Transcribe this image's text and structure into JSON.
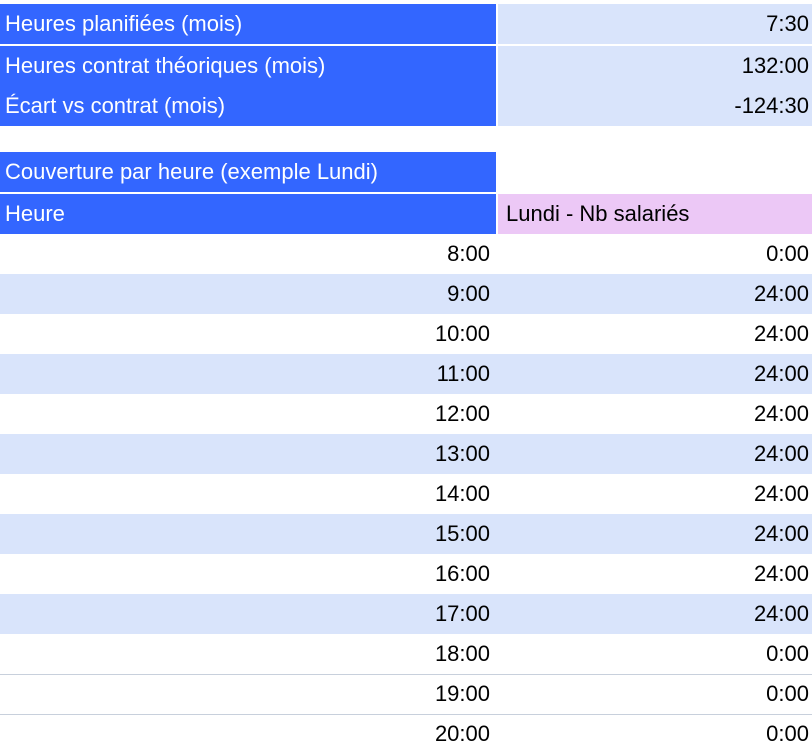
{
  "summary": [
    {
      "label": "Heures planifiées (mois)",
      "value": "7:30"
    },
    {
      "label": "Heures contrat théoriques (mois)",
      "value": "132:00"
    },
    {
      "label": "Écart vs contrat (mois)",
      "value": "-124:30"
    }
  ],
  "coverage": {
    "section_title": "Couverture par heure (exemple Lundi)",
    "col_heure": "Heure",
    "col_lundi": "Lundi - Nb salariés",
    "rows": [
      {
        "hour": "8:00",
        "count": "0:00"
      },
      {
        "hour": "9:00",
        "count": "24:00"
      },
      {
        "hour": "10:00",
        "count": "24:00"
      },
      {
        "hour": "11:00",
        "count": "24:00"
      },
      {
        "hour": "12:00",
        "count": "24:00"
      },
      {
        "hour": "13:00",
        "count": "24:00"
      },
      {
        "hour": "14:00",
        "count": "24:00"
      },
      {
        "hour": "15:00",
        "count": "24:00"
      },
      {
        "hour": "16:00",
        "count": "24:00"
      },
      {
        "hour": "17:00",
        "count": "24:00"
      },
      {
        "hour": "18:00",
        "count": "0:00"
      },
      {
        "hour": "19:00",
        "count": "0:00"
      },
      {
        "hour": "20:00",
        "count": "0:00"
      }
    ]
  },
  "colors": {
    "header_blue": "#3366ff",
    "band_light_blue": "#d9e4fb",
    "header_pink": "#ecc8f6"
  }
}
